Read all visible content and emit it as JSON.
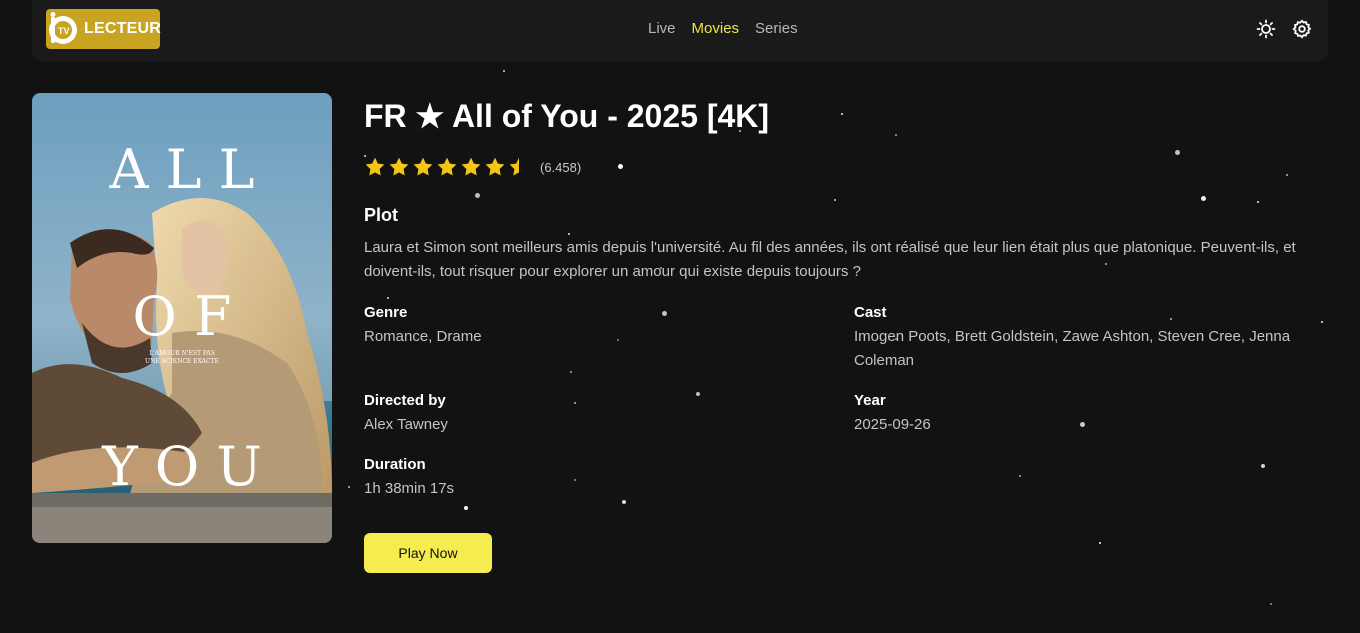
{
  "app": {
    "logo_text": "LECTEUR",
    "logo_badge": "TV"
  },
  "nav": {
    "items": [
      {
        "label": "Live",
        "active": false
      },
      {
        "label": "Movies",
        "active": true
      },
      {
        "label": "Series",
        "active": false
      }
    ]
  },
  "toolbar": {
    "theme_icon": "sun-icon",
    "settings_icon": "gear-icon"
  },
  "poster": {
    "line1": "A L L",
    "line2": "O F",
    "line3": "Y O U",
    "tagline_1": "L'AMOUR N'EST PAS",
    "tagline_2": "UNE SCIENCE EXACTE"
  },
  "movie": {
    "title": "FR ★ All of You - 2025 [4K]",
    "rating_stars": 6.5,
    "rating_max": 7,
    "rating_count": "(6.458)",
    "plot_heading": "Plot",
    "plot": "Laura et Simon sont meilleurs amis depuis l'université. Au fil des années, ils ont réalisé que leur lien était plus que platonique. Peuvent-ils, et doivent-ils, tout risquer pour explorer un amour qui existe depuis toujours ?",
    "genre_label": "Genre",
    "genre": "Romance, Drame",
    "cast_label": "Cast",
    "cast": "Imogen Poots, Brett Goldstein, Zawe Ashton, Steven Cree, Jenna Coleman",
    "director_label": "Directed by",
    "director": "Alex Tawney",
    "year_label": "Year",
    "year": "2025-09-26",
    "duration_label": "Duration",
    "duration": "1h 38min 17s",
    "play_label": "Play Now"
  },
  "colors": {
    "background": "#121212",
    "accent": "#f5ec4f",
    "star": "#f5c518",
    "logo_bg": "#c9a322"
  }
}
